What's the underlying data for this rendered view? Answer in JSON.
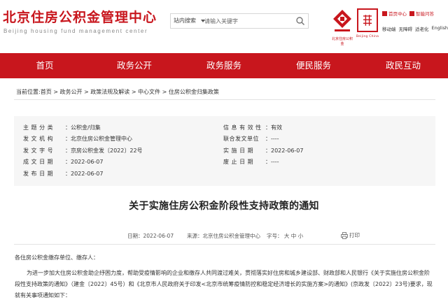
{
  "header": {
    "title_cn": "北京住房公积金管理中心",
    "title_en": "Beijing housing fund management center",
    "search": {
      "scope": "站内搜索",
      "placeholder": "请输入关键字"
    },
    "emblem_text": "北京住房公积金",
    "capital_logo_text": "Beijing China",
    "links": [
      {
        "label": "首页中心"
      },
      {
        "label": "智能问答"
      },
      {
        "label": "移动端"
      },
      {
        "label": "无障碍"
      },
      {
        "label": "适老化"
      },
      {
        "label": "English"
      }
    ]
  },
  "nav": {
    "items": [
      "首页",
      "政务公开",
      "政务服务",
      "便民服务",
      "政民互动"
    ]
  },
  "breadcrumb": "当前位置:首页 > 政务公开 > 政策法规及解读 > 中心文件 > 住房公积金归集政策",
  "info": {
    "left": [
      {
        "key": "主 题 分 类",
        "value": "：公积金/归集"
      },
      {
        "key": "发 文 机 构",
        "value": "：北京住房公积金管理中心"
      },
      {
        "key": "发 文 字 号",
        "value": "：京房公积金发〔2022〕22号"
      },
      {
        "key": "成 文 日 期",
        "value": "：2022-06-07"
      },
      {
        "key": "发 布 日 期",
        "value": "：2022-06-07"
      }
    ],
    "right": [
      {
        "key": "信 息 有 效 性",
        "value": "：有效"
      },
      {
        "key": "联合发文单位",
        "value": "：----"
      },
      {
        "key": "实 施 日 期",
        "value": "：2022-06-07"
      },
      {
        "key": "废 止 日 期",
        "value": "：----"
      }
    ]
  },
  "doc": {
    "title": "关于实施住房公积金阶段性支持政策的通知",
    "date": "日期：2022-06-07",
    "source": "来源：北京住房公积金管理中心",
    "font_size": "字号： 大   中   小",
    "print": "打印",
    "salutation": "各住房公积金缴存单位、缴存人：",
    "paragraph": "为进一步加大住房公积金助企纾困力度，帮助受疫情影响的企业和缴存人共同渡过难关，贯彻落实好住房和城乡建设部、财政部和人民银行《关于实施住房公积金阶段性支持政策的通知》（建金〔2022〕45号）和《北京市人民政府关于印发<北京市统筹疫情防控和稳定经济增长的实施方案>的通知》(京政发〔2022〕23号)要求，现就有关事项通知如下："
  },
  "colors": {
    "brand_red": "#c8161d",
    "panel_gray": "#f6f6f6"
  }
}
